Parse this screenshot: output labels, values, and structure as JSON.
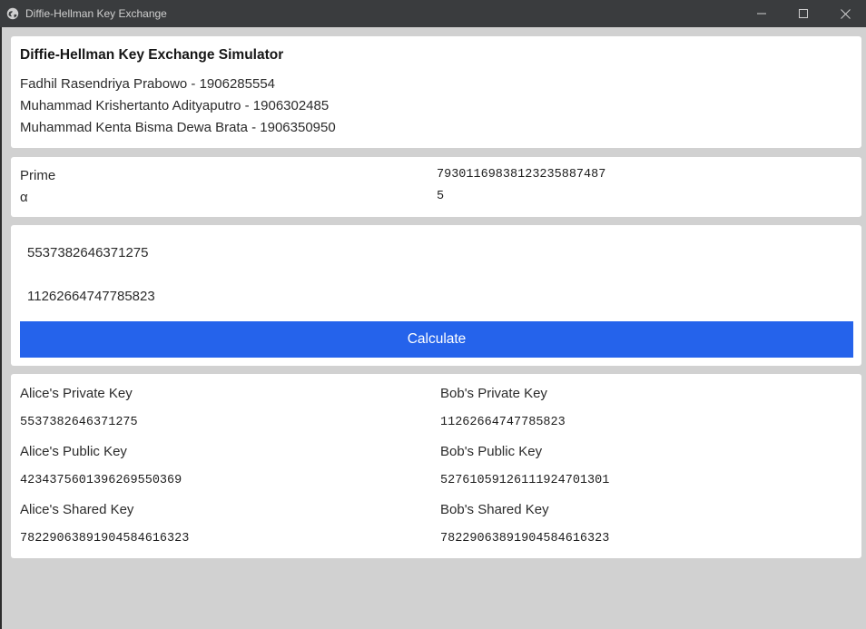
{
  "window": {
    "title": "Diffie-Hellman Key Exchange",
    "app_icon": "globe-icon",
    "controls": [
      "minimize-icon",
      "maximize-icon",
      "close-icon"
    ]
  },
  "header": {
    "title": "Diffie-Hellman Key Exchange Simulator",
    "authors": [
      "Fadhil Rasendriya Prabowo - 1906285554",
      "Muhammad Krishertanto Adityaputro - 1906302485",
      "Muhammad Kenta Bisma Dewa Brata - 1906350950"
    ]
  },
  "params": {
    "prime_label": "Prime",
    "prime_value": "79301169838123235887487",
    "alpha_label": "α",
    "alpha_value": "5"
  },
  "inputs": {
    "alice_private_value": "5537382646371275",
    "bob_private_value": "11262664747785823",
    "calculate_label": "Calculate"
  },
  "results": {
    "alice": {
      "private_label": "Alice's Private Key",
      "private_value": "5537382646371275",
      "public_label": "Alice's Public Key",
      "public_value": "42343756013962695503​69",
      "shared_label": "Alice's Shared Key",
      "shared_value": "78229063891904584616323"
    },
    "bob": {
      "private_label": "Bob's Private Key",
      "private_value": "11262664747785823",
      "public_label": "Bob's Public Key",
      "public_value": "52761059126111924701301",
      "shared_label": "Bob's Shared Key",
      "shared_value": "78229063891904584616323"
    }
  },
  "colors": {
    "titlebar_bg": "#3a3c3e",
    "background": "#d1d1d1",
    "card_bg": "#ffffff",
    "button_bg": "#2563eb",
    "button_text": "#ffffff"
  }
}
